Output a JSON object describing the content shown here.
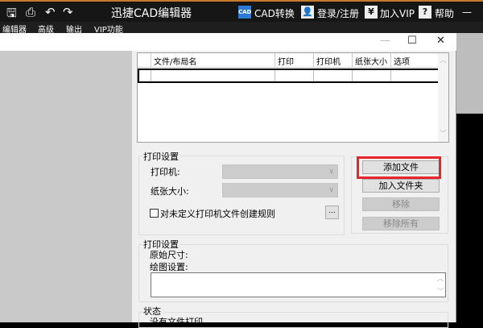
{
  "app": {
    "title": "迅捷CAD编辑器",
    "cad_convert": "CAD转换",
    "login": "登录/注册",
    "vip": "加入VIP",
    "help": "帮助",
    "minimize": "—"
  },
  "menu": [
    "编辑器",
    "高级",
    "输出",
    "VIP功能"
  ],
  "dialog": {
    "window_buttons": {
      "minimize": "—",
      "maximize": "☐",
      "close": "✕"
    },
    "table": {
      "columns": [
        "文件/布局名",
        "打印",
        "打印机",
        "纸张大小",
        "选项"
      ],
      "rows": [
        [
          "",
          "",
          "",
          "",
          ""
        ]
      ]
    },
    "print_settings": {
      "title": "打印设置",
      "printer_label": "打印机:",
      "paper_label": "纸张大小:",
      "printer_value": "",
      "paper_value": "",
      "checkbox_label": "对未定义打印机文件创建规则",
      "checkbox_checked": false,
      "browse": "..."
    },
    "buttons": {
      "add_file": "添加文件",
      "add_folder": "加入文件夹",
      "remove": "移除",
      "remove_all": "移除所有"
    },
    "plot_settings": {
      "title": "打印设置",
      "original_size": "原始尺寸:",
      "plot_settings_label": "绘图设置:"
    },
    "status": {
      "title": "状态",
      "text": "没有文件打印"
    }
  },
  "colors": {
    "highlight": "#e8232a"
  }
}
